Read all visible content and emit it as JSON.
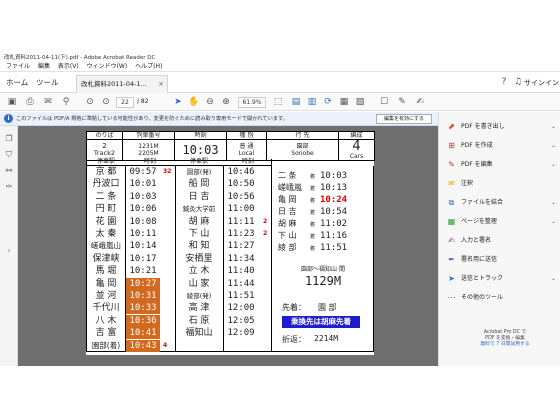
{
  "window": {
    "title": "改札資料2011-04-11(下).pdf - Adobe Acrobat Reader DC"
  },
  "menu": [
    "ファイル",
    "編集",
    "表示(V)",
    "ウィンドウ(W)",
    "ヘルプ(H)"
  ],
  "tabs": {
    "home": "ホーム",
    "tools": "ツール",
    "doc": "改札資料2011-04-1...",
    "signin": "サインイン"
  },
  "toolbar": {
    "page_current": "22",
    "page_total": "/ 82",
    "zoom": "61.9%"
  },
  "notice": {
    "message": "このファイルは PDF/A 規格に準拠している可能性があり、変更を防ぐために読み取り専用モードで開かれています。",
    "button": "編集を有効にする"
  },
  "right_panel": {
    "items": [
      {
        "label": "PDF を書き出し",
        "icon": "export-pdf-icon",
        "color": "#e0301e",
        "chevron": true
      },
      {
        "label": "PDF を作成",
        "icon": "create-pdf-icon",
        "color": "#e0301e",
        "chevron": true
      },
      {
        "label": "PDF を編集",
        "icon": "edit-pdf-icon",
        "color": "#e0301e",
        "chevron": true
      },
      {
        "label": "注釈",
        "icon": "comment-icon",
        "color": "#e6a700",
        "chevron": false
      },
      {
        "label": "ファイルを結合",
        "icon": "combine-files-icon",
        "color": "#2d6cc0",
        "chevron": true
      },
      {
        "label": "ページを整理",
        "icon": "organize-pages-icon",
        "color": "#2e9e3b",
        "chevron": true
      },
      {
        "label": "入力と署名",
        "icon": "fill-sign-icon",
        "color": "#8a3fb8",
        "chevron": false
      },
      {
        "label": "署名用に送信",
        "icon": "send-signature-icon",
        "color": "#8a3fb8",
        "chevron": false
      },
      {
        "label": "送信とトラック",
        "icon": "send-track-icon",
        "color": "#2d6cc0",
        "chevron": true
      },
      {
        "label": "その他のツール",
        "icon": "more-tools-icon",
        "color": "#555555",
        "chevron": false
      }
    ],
    "footer_line1": "Acrobat Pro DC で",
    "footer_line2": "PDF を変換・編集",
    "footer_link": "無料で 7 日間試用する"
  },
  "timetable": {
    "header_labels": {
      "norikiba": "のりば",
      "train_no": "列車番号",
      "time": "時刻",
      "type": "種 別",
      "dest": "行 先",
      "cars": "編成",
      "track": "2",
      "track_en": "Track2",
      "train_1": "1231M",
      "train_2": "2205M",
      "dep_time": "10:03",
      "type_jp": "普 通",
      "type_en": "Local",
      "dest_jp": "園部",
      "dest_en": "Sonobe",
      "cars_num": "4",
      "cars_en": "Cars"
    },
    "col_heads": [
      "停車駅",
      "時刻",
      "停車駅",
      "時刻"
    ],
    "left_rows": [
      {
        "station": "京 都",
        "time": "09:57",
        "badge": "32",
        "orange": false
      },
      {
        "station": "丹波口",
        "time": "10:01",
        "badge": "",
        "orange": false
      },
      {
        "station": "二 条",
        "time": "10:03",
        "badge": "",
        "orange": false
      },
      {
        "station": "円 町",
        "time": "10:06",
        "badge": "",
        "orange": false
      },
      {
        "station": "花 園",
        "time": "10:08",
        "badge": "",
        "orange": false
      },
      {
        "station": "太 秦",
        "time": "10:11",
        "badge": "",
        "orange": false
      },
      {
        "station": "嵯峨嵐山",
        "time": "10:14",
        "badge": "",
        "orange": false
      },
      {
        "station": "保津峡",
        "time": "10:17",
        "badge": "",
        "orange": false
      },
      {
        "station": "馬 堀",
        "time": "10:21",
        "badge": "",
        "orange": false
      },
      {
        "station": "亀 岡",
        "time": "10:27",
        "badge": "",
        "orange": true
      },
      {
        "station": "並 河",
        "time": "10:31",
        "badge": "",
        "orange": true
      },
      {
        "station": "千代川",
        "time": "10:33",
        "badge": "",
        "orange": true
      },
      {
        "station": "八 木",
        "time": "10:36",
        "badge": "",
        "orange": true
      },
      {
        "station": "吉 富",
        "time": "10:41",
        "badge": "",
        "orange": true
      },
      {
        "station": "園部(着)",
        "time": "10:43",
        "badge": "4",
        "orange": true
      }
    ],
    "right_rows": [
      {
        "station": "園部(発)",
        "time": "10:46",
        "badge": ""
      },
      {
        "station": "船 岡",
        "time": "10:50",
        "badge": ""
      },
      {
        "station": "日 吉",
        "time": "10:56",
        "badge": ""
      },
      {
        "station": "鍼灸大学前",
        "time": "11:00",
        "badge": ""
      },
      {
        "station": "胡 麻",
        "time": "11:11",
        "badge": "2"
      },
      {
        "station": "下 山",
        "time": "11:23",
        "badge": "2"
      },
      {
        "station": "和 知",
        "time": "11:27",
        "badge": ""
      },
      {
        "station": "安栖里",
        "time": "11:34",
        "badge": ""
      },
      {
        "station": "立 木",
        "time": "11:40",
        "badge": ""
      },
      {
        "station": "山 家",
        "time": "11:44",
        "badge": ""
      },
      {
        "station": "綾部(発)",
        "time": "11:51",
        "badge": ""
      },
      {
        "station": "高 津",
        "time": "12:00",
        "badge": ""
      },
      {
        "station": "石 原",
        "time": "12:05",
        "badge": ""
      },
      {
        "station": "福知山",
        "time": "12:09",
        "badge": ""
      }
    ],
    "arrivals": [
      {
        "station": "二 条",
        "suffix": "着",
        "time": "10:03",
        "red": false
      },
      {
        "station": "嵯峨嵐",
        "suffix": "着",
        "time": "10:13",
        "red": false
      },
      {
        "station": "亀 岡",
        "suffix": "着",
        "time": "10:24",
        "red": true
      },
      {
        "station": "日 吉",
        "suffix": "着",
        "time": "10:54",
        "red": false
      },
      {
        "station": "胡 麻",
        "suffix": "着",
        "time": "11:02",
        "red": false
      },
      {
        "station": "下 山",
        "suffix": "着",
        "time": "11:16",
        "red": false
      },
      {
        "station": "綾 部",
        "suffix": "着",
        "time": "11:51",
        "red": false
      }
    ],
    "section_label": "園部〜福知山 間",
    "section_train": "1129M",
    "first_label": "先着：",
    "first_value": "園 部",
    "transfer_banner": "乗換先は胡麻先着",
    "turn_label": "折返：",
    "turn_value": "2214M"
  },
  "colors": {
    "orange": "#d2691e",
    "red": "#e00000",
    "banner_blue": "#1d1dcc"
  }
}
